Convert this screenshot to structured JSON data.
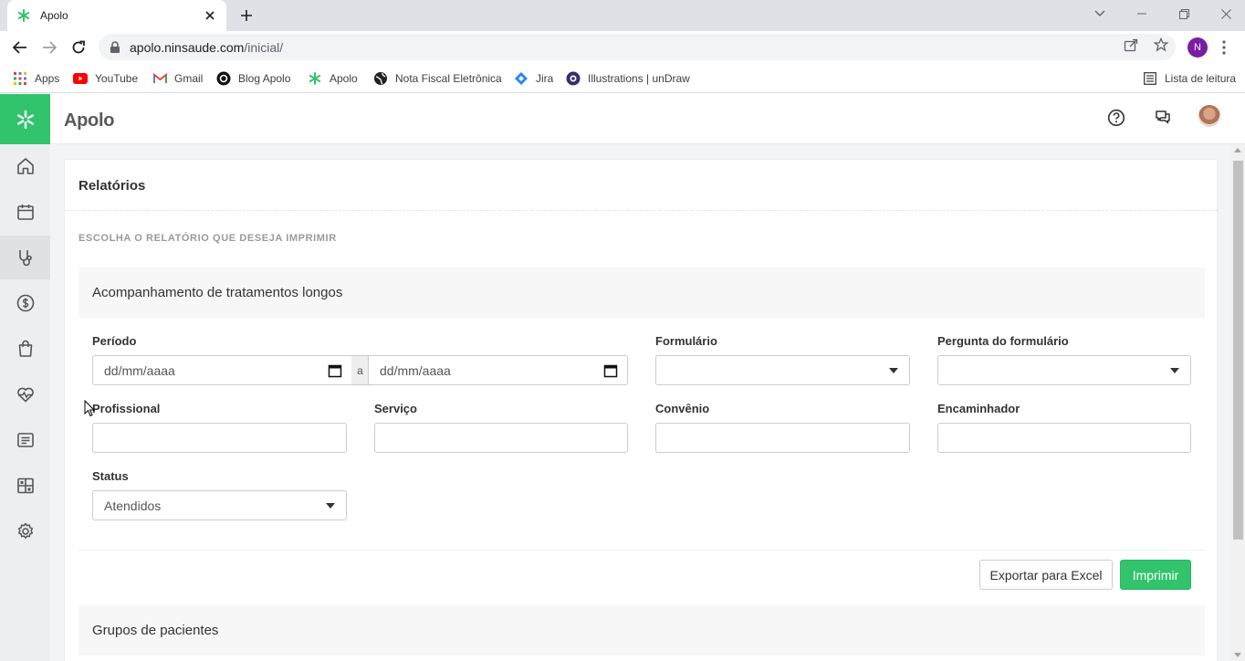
{
  "browser": {
    "tab_title": "Apolo",
    "url_host": "apolo.ninsaude.com",
    "url_path": "/inicial/",
    "profile_initial": "N",
    "bookmarks": [
      {
        "label": "Apps",
        "icon": "apps-grid-icon"
      },
      {
        "label": "YouTube",
        "icon": "youtube-icon"
      },
      {
        "label": "Gmail",
        "icon": "gmail-icon"
      },
      {
        "label": "Blog Apolo",
        "icon": "blog-icon"
      },
      {
        "label": "Apolo",
        "icon": "apolo-icon"
      },
      {
        "label": "Nota Fiscal Eletrônica",
        "icon": "globe-icon"
      },
      {
        "label": "Jira",
        "icon": "jira-icon"
      },
      {
        "label": "Illustrations | unDraw",
        "icon": "undraw-icon"
      }
    ],
    "reading_list": "Lista de leitura"
  },
  "app": {
    "brand": "Apolo",
    "accent_color": "#31c46c",
    "sidebar": [
      {
        "name": "home-icon"
      },
      {
        "name": "calendar-icon"
      },
      {
        "name": "stethoscope-icon",
        "active": true
      },
      {
        "name": "dollar-icon"
      },
      {
        "name": "shopping-bag-icon"
      },
      {
        "name": "heart-pulse-icon"
      },
      {
        "name": "list-icon"
      },
      {
        "name": "dashboard-icon"
      },
      {
        "name": "gear-icon"
      }
    ]
  },
  "page": {
    "title": "Relatórios",
    "subtitle": "ESCOLHA O RELATÓRIO QUE DESEJA IMPRIMIR",
    "report_title": "Acompanhamento de tratamentos longos",
    "fields": {
      "periodo": "Período",
      "date_placeholder": "dd/mm/aaaa",
      "range_sep": "a",
      "formulario": "Formulário",
      "pergunta": "Pergunta do formulário",
      "profissional": "Profissional",
      "servico": "Serviço",
      "convenio": "Convênio",
      "encaminhador": "Encaminhador",
      "status": "Status",
      "status_value": "Atendidos"
    },
    "buttons": {
      "export": "Exportar para Excel",
      "print": "Imprimir"
    },
    "next_section": "Grupos de pacientes"
  }
}
